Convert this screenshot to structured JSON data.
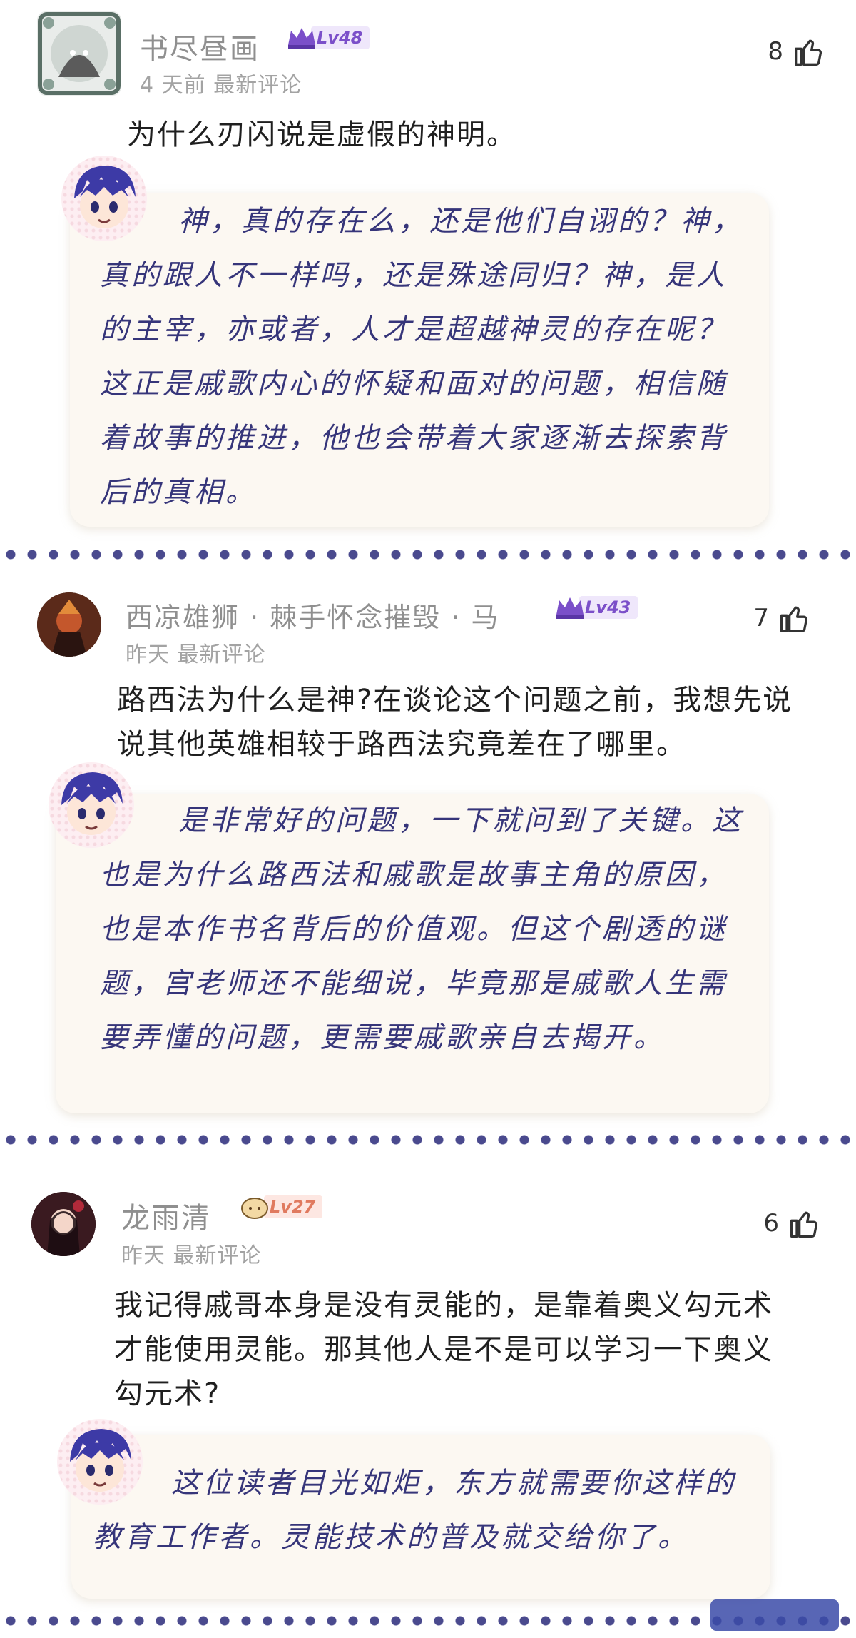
{
  "comments": [
    {
      "username": "书尽昼画",
      "level": "Lv48",
      "meta": "4 天前  最新评论",
      "likes": "8",
      "text": "为什么刃闪说是虚假的神明。",
      "reply": "神，真的存在么，还是他们自诩的？神，真的跟人不一样吗，还是殊途同归？神，是人的主宰，亦或者，人才是超越神灵的存在呢？这正是戚歌内心的怀疑和面对的问题，相信随着故事的推进，他也会带着大家逐渐去探索背后的真相。"
    },
    {
      "username": "西凉雄狮 · 棘手怀念摧毁 · 马",
      "level": "Lv43",
      "meta": "昨天  最新评论",
      "likes": "7",
      "text": "路西法为什么是神?在谈论这个问题之前，我想先说说其他英雄相较于路西法究竟差在了哪里。",
      "reply": "是非常好的问题，一下就问到了关键。这也是为什么路西法和戚歌是故事主角的原因，也是本作书名背后的价值观。但这个剧透的谜题，宫老师还不能细说，毕竟那是戚歌人生需要弄懂的问题，更需要戚歌亲自去揭开。"
    },
    {
      "username": "龙雨清",
      "level": "Lv27",
      "meta": "昨天  最新评论",
      "likes": "6",
      "text": "我记得戚哥本身是没有灵能的，是靠着奥义勾元术才能使用灵能。那其他人是不是可以学习一下奥义勾元术?",
      "reply": "这位读者目光如炬，东方就需要你这样的教育工作者。灵能技术的普及就交给你了。"
    }
  ],
  "colors": {
    "reply_text": "#36357a",
    "divider_dots": "#4a4a8e",
    "badge_purple": "#7b4fc9",
    "badge_orange": "#e07a5f"
  }
}
